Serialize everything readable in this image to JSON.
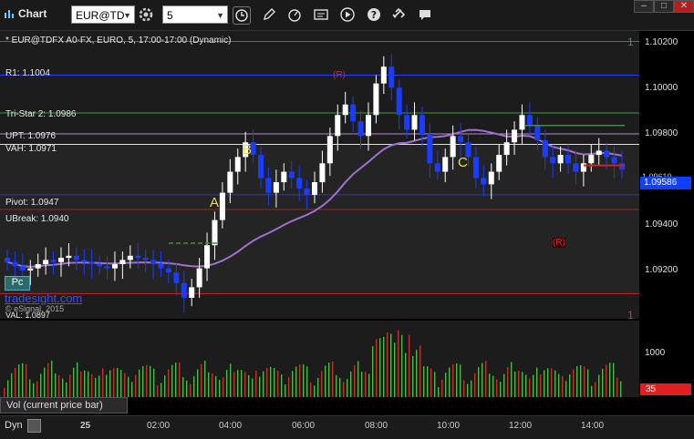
{
  "toolbar": {
    "title": "Chart",
    "symbol": "EUR@TD",
    "interval": "5",
    "minimize": "–",
    "maximize": "□",
    "close": "✕"
  },
  "chart": {
    "header": "* EUR@TDFX A0-FX, EURO, 5, 17:00-17:00 (Dynamic)",
    "levels": {
      "r1": "R1: 1.1004",
      "tristar": "Tri-Star 2: 1.0986",
      "upt": "UPT: 1.0976",
      "vah": "VAH: 1.0971",
      "pivot": "Pivot: 1.0947",
      "ubreak": "UBreak: 1.0940",
      "val": "VAL: 1.0897"
    },
    "labels": {
      "a": "A",
      "b": "B",
      "c": "C",
      "r_top": "(R)",
      "r_mid": "(R)"
    },
    "badge": "Pc",
    "watermark": "tradesight.com",
    "copyright": "© eSignal, 2015",
    "y_ticks": [
      "1.10200",
      "1.10000",
      "1.09800",
      "1.09600",
      "1.09400",
      "1.09200"
    ],
    "price_tag": "1.09586",
    "price_tag2": "1.09610",
    "top_marker": "1",
    "bot_marker": "1",
    "colors": {
      "up": "#ffffff",
      "down": "#1a3cff",
      "ma": "#a070d0"
    }
  },
  "volume": {
    "label": "Vol (current price bar)",
    "tick": "1000",
    "last": "35"
  },
  "xaxis": {
    "dyn": "Dyn",
    "ticks": [
      "25",
      "02:00",
      "04:00",
      "06:00",
      "08:00",
      "10:00",
      "12:00",
      "14:00"
    ]
  },
  "chart_data": {
    "type": "candlestick",
    "ylim": [
      1.0888,
      1.1025
    ],
    "closes": [
      1.0915,
      1.0913,
      1.0911,
      1.0912,
      1.0914,
      1.0916,
      1.0915,
      1.0917,
      1.0918,
      1.0916,
      1.0915,
      1.0914,
      1.0913,
      1.0912,
      1.0914,
      1.0916,
      1.0918,
      1.0917,
      1.0916,
      1.0914,
      1.0912,
      1.091,
      1.0905,
      1.0898,
      1.0903,
      1.0912,
      1.0923,
      1.0935,
      1.0948,
      1.0958,
      1.0965,
      1.0972,
      1.0966,
      1.0955,
      1.0948,
      1.0953,
      1.0958,
      1.0955,
      1.095,
      1.0947,
      1.0953,
      1.0962,
      1.0975,
      1.0985,
      1.099,
      1.0982,
      1.0975,
      1.0985,
      1.1,
      1.1008,
      1.0998,
      1.0985,
      1.0978,
      1.0985,
      1.0976,
      1.0962,
      1.0958,
      1.0965,
      1.0975,
      1.0972,
      1.0965,
      1.0955,
      1.0952,
      1.0958,
      1.0966,
      1.0972,
      1.0978,
      1.0985,
      1.098,
      1.0973,
      1.0965,
      1.0962,
      1.0966,
      1.0962,
      1.0958,
      1.0962,
      1.0966,
      1.0968,
      1.0965,
      1.0962,
      1.0959
    ]
  }
}
